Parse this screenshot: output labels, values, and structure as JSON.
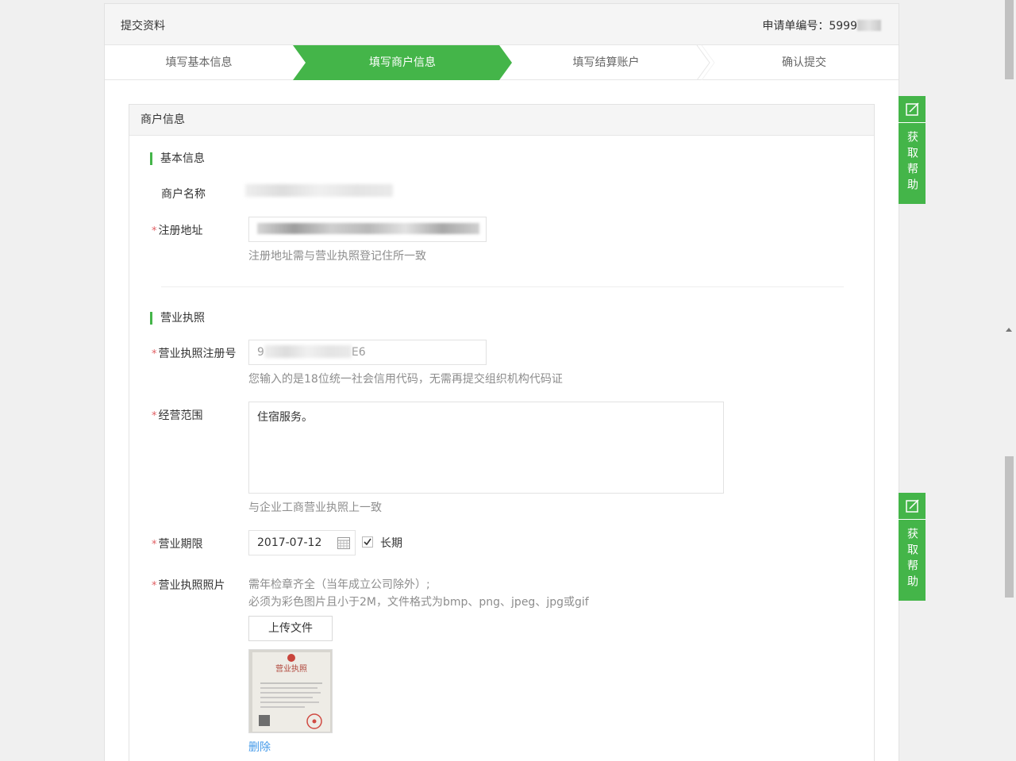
{
  "header": {
    "title": "提交资料",
    "application_no_label": "申请单编号：",
    "application_no_visible": "5999"
  },
  "steps": [
    {
      "label": "填写基本信息",
      "active": false
    },
    {
      "label": "填写商户信息",
      "active": true
    },
    {
      "label": "填写结算账户",
      "active": false
    },
    {
      "label": "确认提交",
      "active": false
    }
  ],
  "section": {
    "title": "商户信息",
    "basic_info": {
      "title": "基本信息",
      "merchant_name_label": "商户名称",
      "reg_address_label": "注册地址",
      "reg_address_hint": "注册地址需与营业执照登记住所一致"
    },
    "license": {
      "title": "营业执照",
      "reg_no_label": "营业执照注册号",
      "reg_no_prefix": "9",
      "reg_no_suffix": "E6",
      "reg_no_hint": "您输入的是18位统一社会信用代码，无需再提交组织机构代码证",
      "scope_label": "经营范围",
      "scope_value": "住宿服务。",
      "scope_hint": "与企业工商营业执照上一致",
      "period_label": "营业期限",
      "period_date": "2017-07-12",
      "long_term_label": "长期",
      "long_term_checked": true,
      "photo_label": "营业执照照片",
      "photo_hint_1": "需年检章齐全（当年成立公司除外）;",
      "photo_hint_2": "必须为彩色图片且小于2M，文件格式为bmp、png、jpeg、jpg或gif",
      "upload_label": "上传文件",
      "thumb_title": "营业执照",
      "delete_label": "删除"
    }
  },
  "help_widget": {
    "label": "获取帮助"
  },
  "colors": {
    "accent": "#44b549",
    "required": "#e15f63",
    "link": "#459ae9"
  }
}
